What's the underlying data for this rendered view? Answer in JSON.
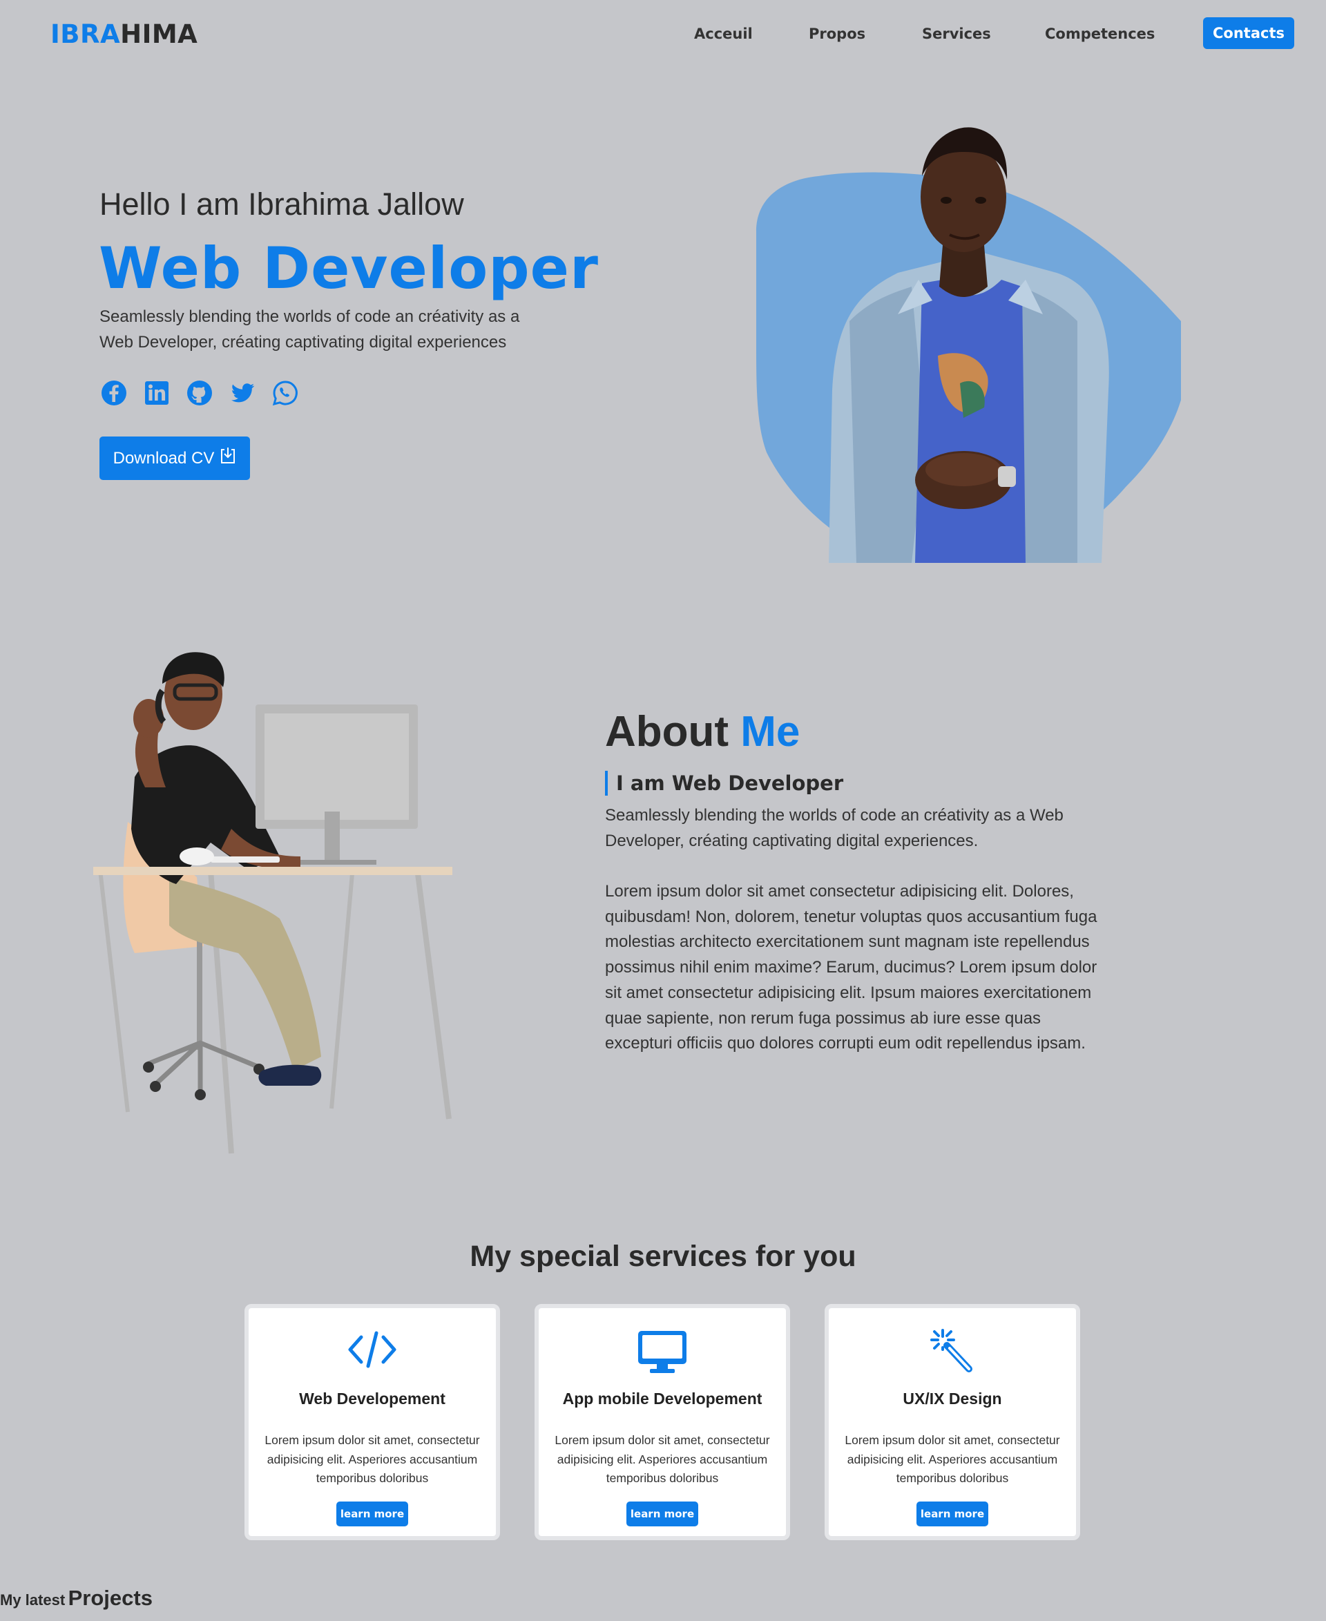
{
  "nav": {
    "logo_part1": "IBRA",
    "logo_part2": "HIMA",
    "links": [
      "Acceuil",
      "Propos",
      "Services",
      "Competences"
    ],
    "cta": "Contacts"
  },
  "hero": {
    "greeting": "Hello I am Ibrahima Jallow",
    "role": "Web Developer",
    "description": "Seamlessly blending the worlds of code an créativity as a Web Developer, créating captivating digital experiences",
    "socials": [
      "facebook-icon",
      "linkedin-icon",
      "github-icon",
      "twitter-icon",
      "whatsapp-icon"
    ],
    "cv_button": "Download CV"
  },
  "about": {
    "title_part1": "About",
    "title_part2": "Me",
    "subtitle": "I am Web Developer",
    "intro": "Seamlessly blending the worlds of code an créativity as a Web Developer, créating captivating digital experiences.",
    "body": "Lorem ipsum dolor sit amet consectetur adipisicing elit. Dolores, quibusdam! Non, dolorem, tenetur voluptas quos accusantium fuga molestias architecto exercitationem sunt magnam iste repellendus possimus nihil enim maxime? Earum, ducimus? Lorem ipsum dolor sit amet consectetur adipisicing elit. Ipsum maiores exercitationem quae sapiente, non rerum fuga possimus ab iure esse quas excepturi officiis quo dolores corrupti eum odit repellendus ipsam."
  },
  "services": {
    "title": "My special services for you",
    "cards": [
      {
        "icon": "code-icon",
        "title": "Web Developement",
        "text": "Lorem ipsum dolor sit amet, consectetur adipisicing elit. Asperiores accusantium temporibus doloribus",
        "button": "learn more"
      },
      {
        "icon": "desktop-icon",
        "title": "App mobile Developement",
        "text": "Lorem ipsum dolor sit amet, consectetur adipisicing elit. Asperiores accusantium temporibus doloribus",
        "button": "learn more"
      },
      {
        "icon": "magic-wand-icon",
        "title": "UX/IX Design",
        "text": "Lorem ipsum dolor sit amet, consectetur adipisicing elit. Asperiores accusantium temporibus doloribus",
        "button": "learn more"
      }
    ]
  },
  "projects": {
    "small": "My latest",
    "large": "Projects"
  },
  "colors": {
    "accent": "#0e7de8",
    "background": "#c5c6ca"
  }
}
